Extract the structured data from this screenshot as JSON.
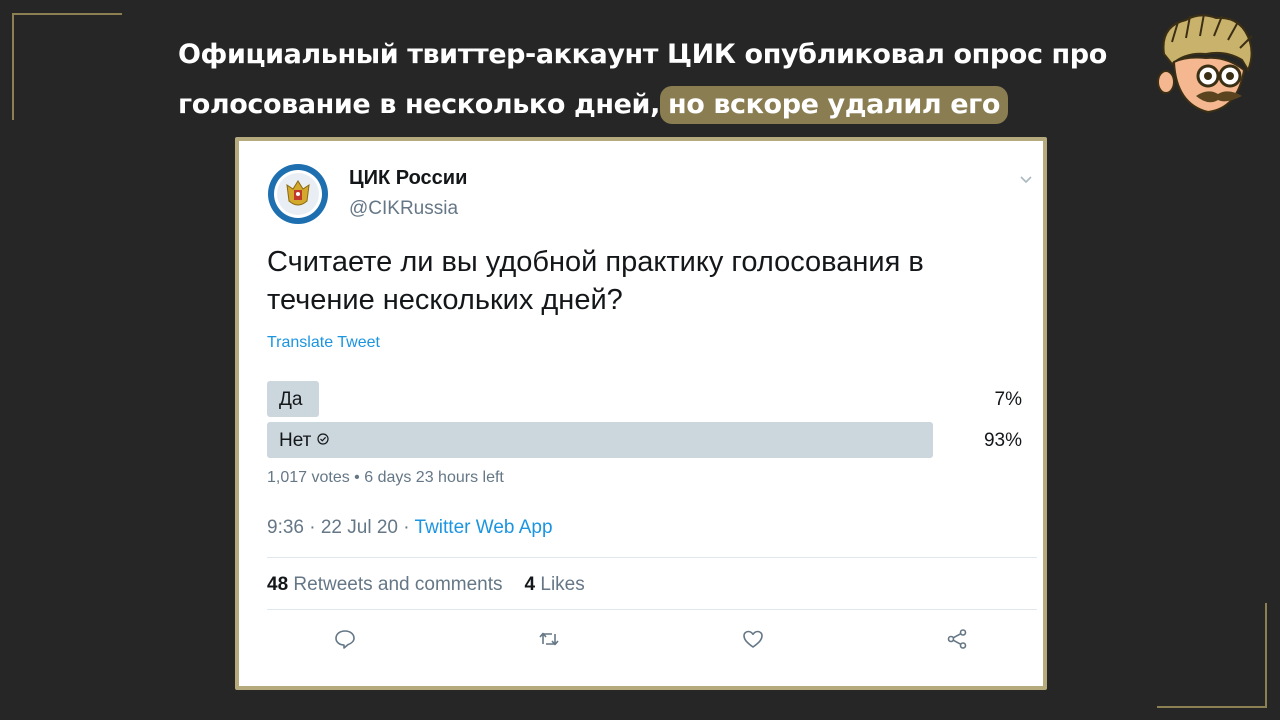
{
  "headline": {
    "text": "Официальный твиттер-аккаунт ЦИК опубликовал опрос про голосование в несколько дней,",
    "highlight": "но вскоре удалил его"
  },
  "tweet": {
    "display_name": "ЦИК России",
    "handle": "@CIKRussia",
    "text": "Считаете ли вы удобной практику голосования в течение нескольких дней?",
    "translate_label": "Translate Tweet",
    "poll": {
      "options": [
        {
          "label": "Да",
          "percent": "7%",
          "share": 0.07,
          "winner": false
        },
        {
          "label": "Нет",
          "percent": "93%",
          "share": 0.93,
          "winner": true
        }
      ],
      "meta": "1,017 votes • 6 days 23 hours left"
    },
    "time": "9:36 · 22 Jul 20 ·",
    "source": "Twitter Web App",
    "stats": {
      "retweets_count": "48",
      "retweets_label": "Retweets and comments",
      "likes_count": "4",
      "likes_label": "Likes"
    },
    "actions": [
      "reply-icon",
      "retweet-icon",
      "like-icon",
      "share-icon"
    ]
  },
  "colors": {
    "background": "#262626",
    "accent_gold": "#8a7d52",
    "card_border": "#b5aa7e",
    "twitter_blue": "#1b95e0",
    "poll_bar": "#ccd6dd",
    "muted_text": "#657786"
  }
}
